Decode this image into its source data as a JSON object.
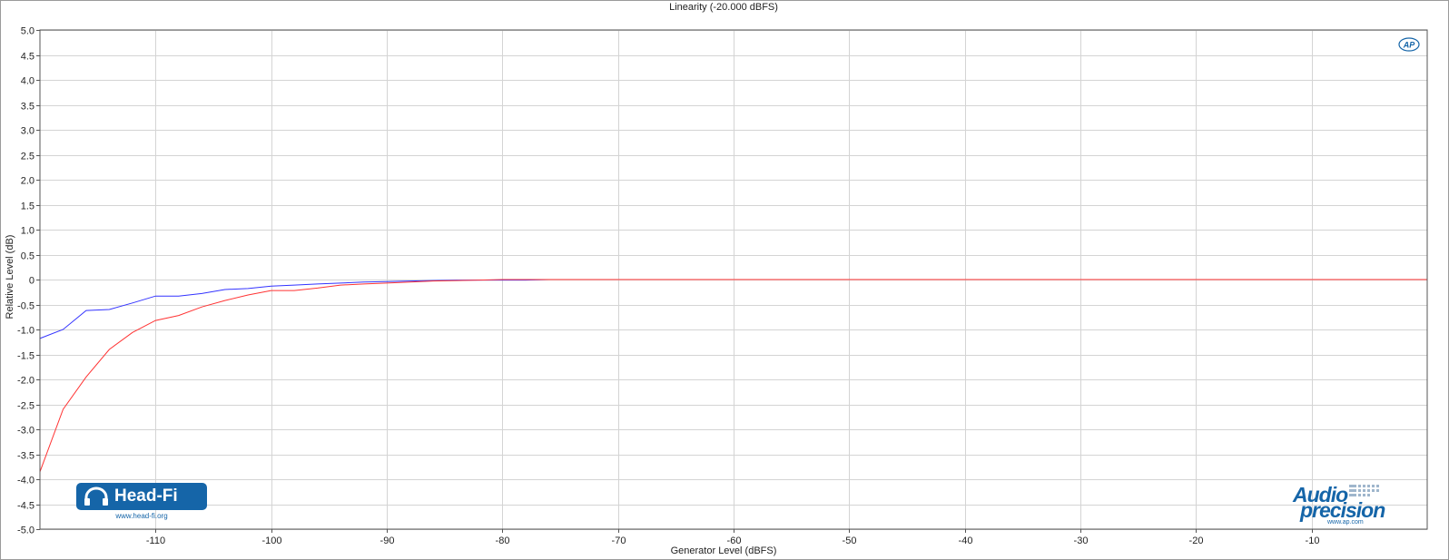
{
  "chart_data": {
    "type": "line",
    "title": "Linearity (-20.000 dBFS)",
    "xlabel": "Generator Level (dBFS)",
    "ylabel": "Relative Level (dB)",
    "xlim": [
      -120,
      0
    ],
    "ylim": [
      -5.0,
      5.0
    ],
    "grid": true,
    "x_ticks": [
      -110,
      -100,
      -90,
      -80,
      -70,
      -60,
      -50,
      -40,
      -30,
      -20,
      -10
    ],
    "x_tick_labels": [
      "-110",
      "-100",
      "-90",
      "-80",
      "-70",
      "-60",
      "-50",
      "-40",
      "-30",
      "-20",
      "-10"
    ],
    "y_ticks": [
      5.0,
      4.5,
      4.0,
      3.5,
      3.0,
      2.5,
      2.0,
      1.5,
      1.0,
      0.5,
      0,
      -0.5,
      -1.0,
      -1.5,
      -2.0,
      -2.5,
      -3.0,
      -3.5,
      -4.0,
      -4.5,
      -5.0
    ],
    "y_tick_labels": [
      "5.0",
      "4.5",
      "4.0",
      "3.5",
      "3.0",
      "2.5",
      "2.0",
      "1.5",
      "1.0",
      "0.5",
      "0",
      "-0.5",
      "-1.0",
      "-1.5",
      "-2.0",
      "-2.5",
      "-3.0",
      "-3.5",
      "-4.0",
      "-4.5",
      "-5.0"
    ],
    "series": [
      {
        "color": "#3333ff",
        "x": [
          -120,
          -118,
          -116,
          -114,
          -112,
          -110,
          -108,
          -106,
          -104,
          -102,
          -100,
          -98,
          -96,
          -94,
          -92,
          -90,
          -88,
          -86,
          -84,
          -82,
          -80,
          -78,
          -76,
          -74,
          -72,
          -70,
          -60,
          -50,
          -40,
          -30,
          -20,
          -10,
          0
        ],
        "y": [
          -1.18,
          -1.0,
          -0.62,
          -0.6,
          -0.47,
          -0.33,
          -0.33,
          -0.28,
          -0.2,
          -0.18,
          -0.13,
          -0.11,
          -0.09,
          -0.07,
          -0.05,
          -0.04,
          -0.03,
          -0.02,
          -0.01,
          -0.01,
          -0.01,
          -0.01,
          0.0,
          0.0,
          0.0,
          0.0,
          0.0,
          0.0,
          0.0,
          0.0,
          0.0,
          0.0,
          0.0
        ]
      },
      {
        "color": "#ff3333",
        "x": [
          -120,
          -118,
          -116,
          -114,
          -112,
          -110,
          -108,
          -106,
          -104,
          -102,
          -100,
          -98,
          -96,
          -94,
          -92,
          -90,
          -88,
          -86,
          -84,
          -82,
          -80,
          -78,
          -76,
          -74,
          -72,
          -70,
          -60,
          -50,
          -40,
          -30,
          -20,
          -10,
          0
        ],
        "y": [
          -3.85,
          -2.6,
          -1.95,
          -1.4,
          -1.06,
          -0.82,
          -0.72,
          -0.55,
          -0.42,
          -0.31,
          -0.22,
          -0.22,
          -0.17,
          -0.11,
          -0.09,
          -0.07,
          -0.05,
          -0.03,
          -0.02,
          -0.01,
          0.0,
          0.0,
          0.0,
          0.0,
          0.0,
          0.0,
          0.0,
          0.0,
          0.0,
          0.0,
          0.0,
          0.0,
          0.0
        ]
      }
    ]
  },
  "logos": {
    "headfi_text": "Head-Fi",
    "headfi_url": "www.head-fi.org",
    "ap_line1": "Audio",
    "ap_line2": "precision",
    "ap_url": "www.ap.com",
    "ap_badge": "AP"
  },
  "colors": {
    "grid": "#d4d4d4",
    "axis": "#555555",
    "brand_blue": "#1565a8"
  }
}
